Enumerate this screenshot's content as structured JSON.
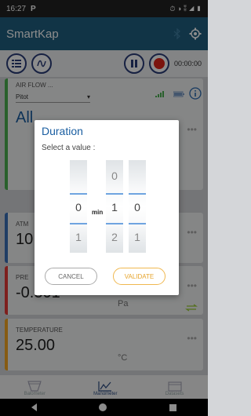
{
  "status": {
    "time": "16:27",
    "app_icon": "P",
    "right": "⏱ ◑ ⁑ ◢ ▮"
  },
  "appbar": {
    "title": "SmartKap"
  },
  "toolbar": {
    "timer": "00:00:00"
  },
  "cards": {
    "airflow": {
      "title": "AIR FLOW ...",
      "select": "Pitot",
      "value": "All"
    },
    "atm": {
      "title": "ATM",
      "value": "10"
    },
    "pressure": {
      "title": "PRE",
      "value": "-0.301",
      "unit": "Pa"
    },
    "temperature": {
      "title": "TEMPERATURE",
      "value": "25.00",
      "unit": "°C"
    },
    "menu_dots": "•••"
  },
  "nav": {
    "balometer": "Balometer",
    "manometer": "Manometer",
    "datasets": "Datasets"
  },
  "dialog": {
    "title": "Duration",
    "subtitle": "Select a value :",
    "min_label": "min",
    "col_minutes": {
      "above": "",
      "current": "0",
      "below": "1"
    },
    "col_sec_tens": {
      "above": "0",
      "current": "1",
      "below": "2"
    },
    "col_sec_ones": {
      "above": "",
      "current": "0",
      "below": "1"
    },
    "cancel": "CANCEL",
    "validate": "VALIDATE"
  },
  "colors": {
    "accent": "#1f5f80",
    "validate": "#e6a42c",
    "record": "#e0261b"
  }
}
